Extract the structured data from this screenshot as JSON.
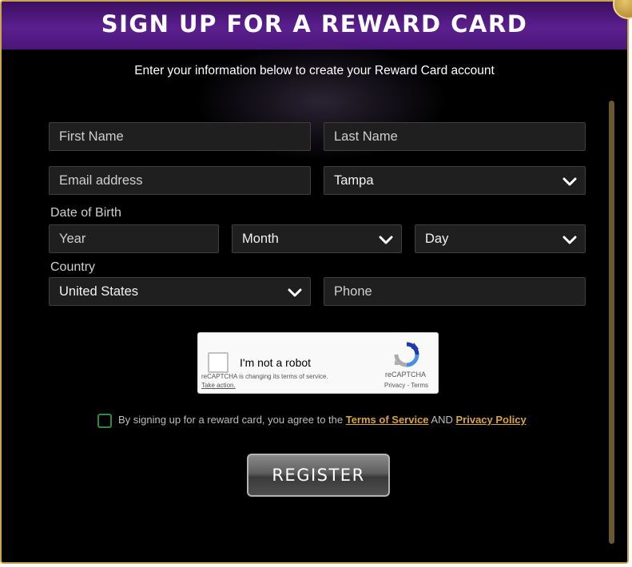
{
  "dialog": {
    "title": "SIGN UP FOR A REWARD CARD",
    "intro": "Enter your information below to create your Reward Card account"
  },
  "form": {
    "first_name": {
      "placeholder": "First Name"
    },
    "last_name": {
      "placeholder": "Last Name"
    },
    "email": {
      "placeholder": "Email address"
    },
    "location": {
      "selected": "Tampa"
    },
    "dob_label": "Date of Birth",
    "year": {
      "placeholder": "Year"
    },
    "month": {
      "selected": "Month"
    },
    "day": {
      "selected": "Day"
    },
    "country_label": "Country",
    "country": {
      "selected": "United States"
    },
    "phone": {
      "placeholder": "Phone"
    }
  },
  "captcha": {
    "label": "I'm not a robot",
    "notice": "reCAPTCHA is changing its terms of service.",
    "take_action": "Take action.",
    "brand": "reCAPTCHA",
    "privacy": "Privacy",
    "separator": " - ",
    "terms": "Terms"
  },
  "agreement": {
    "prefix": "By signing up for a reward card, you agree to the ",
    "terms_link": "Terms of Service",
    "and": " AND ",
    "privacy_link": "Privacy Policy"
  },
  "register_label": "REGISTER",
  "icons": {
    "close": "close-icon",
    "chevron": "chevron-down-icon",
    "recaptcha": "recaptcha-logo-icon"
  },
  "colors": {
    "header_purple": "#5b1f8e",
    "link_gold": "#d8a53d",
    "checkbox_green": "#2e8b3b",
    "frame_gold": "#c9a64a"
  }
}
